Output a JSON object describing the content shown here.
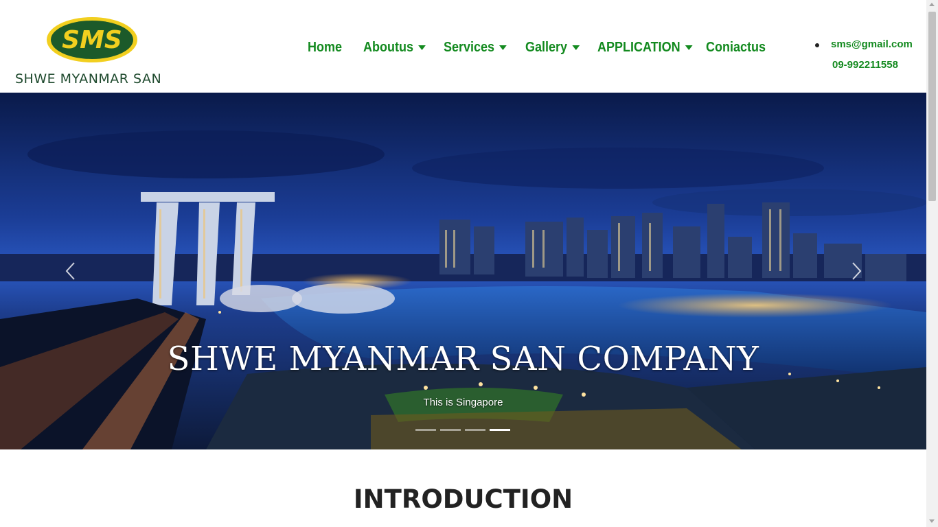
{
  "brand": {
    "logo_initials": "SMS",
    "name": "SHWE MYANMAR SAN",
    "colors": {
      "badge_green": "#1c5a2a",
      "badge_yellow": "#f2cf1f",
      "nav_green": "#138a1f"
    }
  },
  "nav": {
    "items": [
      {
        "label": "Home",
        "dropdown": false
      },
      {
        "label": "Aboutus",
        "dropdown": true
      },
      {
        "label": "Services",
        "dropdown": true
      },
      {
        "label": "Gallery",
        "dropdown": true
      },
      {
        "label": "APPLICATION",
        "dropdown": true
      },
      {
        "label": "Coniactus",
        "dropdown": false
      }
    ]
  },
  "contact": {
    "email": "sms@gmail.com",
    "phone": "09-992211558"
  },
  "carousel": {
    "caption_title": "SHWE MYANMAR SAN COMPANY",
    "caption_subtitle": "This is Singapore",
    "slide_count": 4,
    "active_index": 3
  },
  "intro": {
    "title": "INTRODUCTION"
  }
}
